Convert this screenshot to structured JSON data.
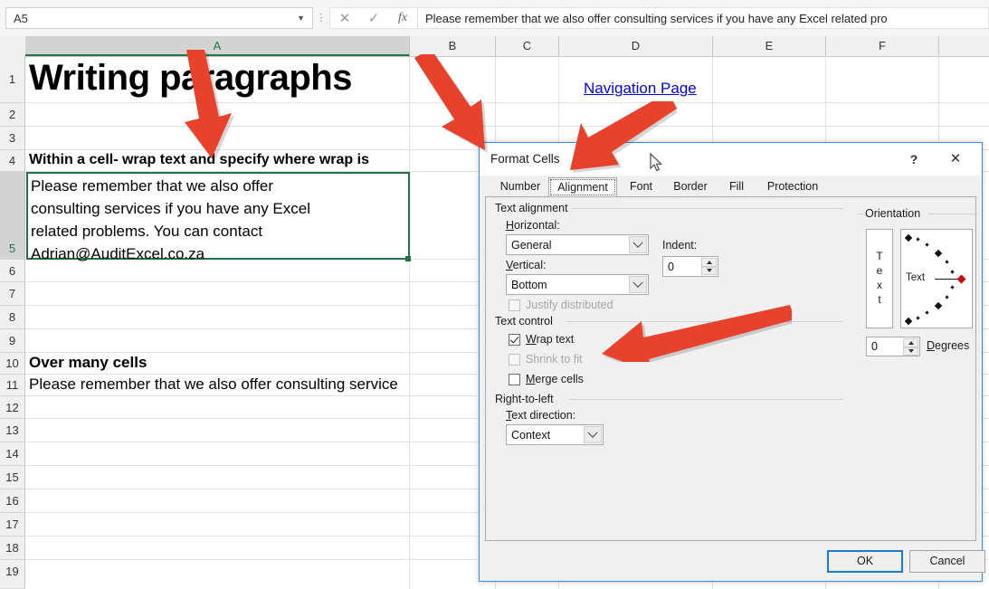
{
  "formula_bar": {
    "name_box_value": "A5",
    "cancel_icon": "cancel-x-icon",
    "confirm_icon": "confirm-check-icon",
    "fx_label": "fx",
    "formula_value": "Please remember that we also offer consulting services if you have any Excel related pro"
  },
  "sheet": {
    "columns": [
      "A",
      "B",
      "C",
      "D",
      "E",
      "F"
    ],
    "selected_column": "A",
    "rows": [
      "1",
      "2",
      "3",
      "4",
      "5",
      "6",
      "7",
      "8",
      "9",
      "10",
      "11",
      "12",
      "13",
      "14",
      "15",
      "16",
      "17",
      "18",
      "19"
    ],
    "selected_row": "5",
    "cells": {
      "a1": "Writing paragraphs",
      "a4": "Within a cell- wrap text and specify where wrap is",
      "a5": "Please remember that we also offer\nconsulting services if you have any Excel\nrelated problems. You can contact\nAdrian@AuditExcel.co.za",
      "a11": "Over many cells",
      "a12": "Please remember that we also offer consulting service",
      "d3_link": "Navigation Page"
    },
    "link_color": "#0000EE",
    "selection_color": "#217346"
  },
  "annotations": {
    "arrow_color": "#E8412C",
    "arrows": [
      {
        "name": "arrow-to-cell-a4",
        "target": "Within a cell heading"
      },
      {
        "name": "arrow-to-dialog-title",
        "target": "Format Cells dialog"
      },
      {
        "name": "arrow-to-alignment-tab",
        "target": "Alignment tab"
      },
      {
        "name": "arrow-to-wrap-text",
        "target": "Wrap text checkbox"
      }
    ]
  },
  "dialog": {
    "title": "Format Cells",
    "help_label": "?",
    "close_label": "✕",
    "tabs": [
      {
        "label": "Number",
        "active": false
      },
      {
        "label": "Alignment",
        "active": true
      },
      {
        "label": "Font",
        "active": false
      },
      {
        "label": "Border",
        "active": false
      },
      {
        "label": "Fill",
        "active": false
      },
      {
        "label": "Protection",
        "active": false
      }
    ],
    "text_alignment": {
      "group_label": "Text alignment",
      "horizontal_label": "Horizontal:",
      "horizontal_value": "General",
      "indent_label": "Indent:",
      "indent_value": "0",
      "vertical_label": "Vertical:",
      "vertical_value": "Bottom",
      "justify_distributed_label": "Justify distributed",
      "justify_distributed_checked": false,
      "justify_distributed_disabled": true
    },
    "text_control": {
      "group_label": "Text control",
      "wrap_text_label": "Wrap text",
      "wrap_text_checked": true,
      "shrink_to_fit_label": "Shrink to fit",
      "shrink_to_fit_checked": false,
      "shrink_to_fit_disabled": true,
      "merge_cells_label": "Merge cells",
      "merge_cells_checked": false
    },
    "right_to_left": {
      "group_label": "Right-to-left",
      "text_direction_label": "Text direction:",
      "text_direction_value": "Context"
    },
    "orientation": {
      "group_label": "Orientation",
      "vertical_text_label": "Text",
      "dial_text_label": "Text",
      "degrees_value": "0",
      "degrees_label": "Degrees",
      "marker_color": "#cc0000"
    },
    "buttons": {
      "ok": "OK",
      "cancel": "Cancel"
    }
  }
}
